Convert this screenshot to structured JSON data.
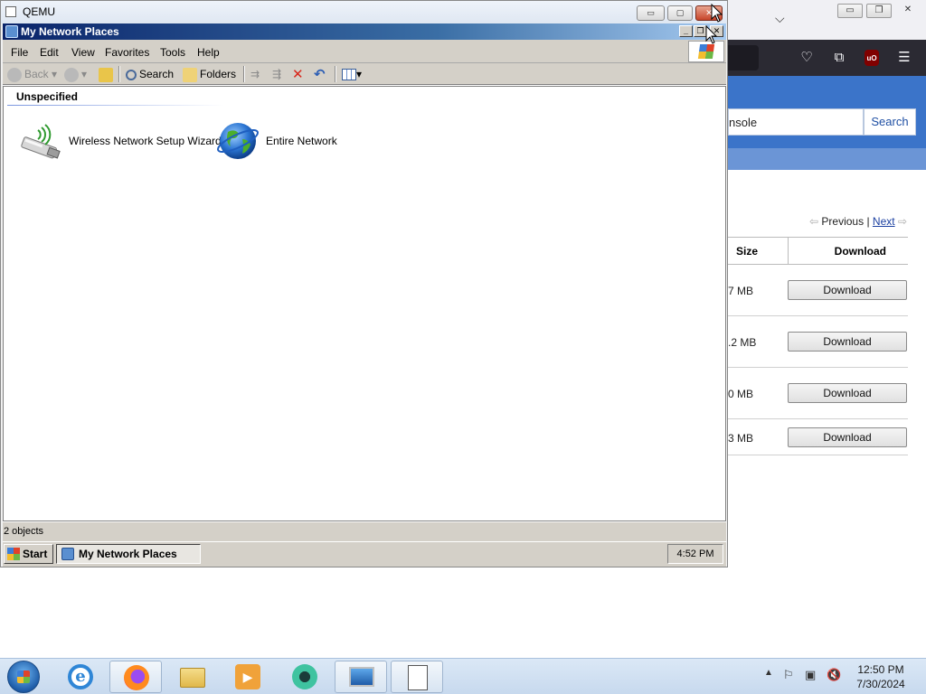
{
  "qemu": {
    "title": "QEMU",
    "buttons": {
      "minimize": "▭",
      "maximize": "▢",
      "close": "✕"
    }
  },
  "xp_window": {
    "title": "My Network Places",
    "menu": [
      "File",
      "Edit",
      "View",
      "Favorites",
      "Tools",
      "Help"
    ],
    "toolbar": {
      "back": "Back",
      "search": "Search",
      "folders": "Folders"
    },
    "group_header": "Unspecified",
    "items": [
      {
        "label": "Wireless Network Setup Wizard",
        "icon": "wireless-usb-icon"
      },
      {
        "label": "Entire Network",
        "icon": "globe-icon"
      }
    ],
    "status": "2 objects"
  },
  "xp_taskbar": {
    "start": "Start",
    "task": "My Network Places",
    "clock": "4:52 PM"
  },
  "browser": {
    "search_value": "nsole",
    "search_button": "Search",
    "pager": {
      "previous": "Previous",
      "separator": "|",
      "next": "Next"
    },
    "table": {
      "headers": {
        "size": "Size",
        "download": "Download"
      },
      "rows": [
        {
          "size": "7 MB",
          "button": "Download"
        },
        {
          "size": ".2 MB",
          "button": "Download"
        },
        {
          "size": "0 MB",
          "button": "Download"
        },
        {
          "size": "3 MB",
          "button": "Download"
        }
      ]
    }
  },
  "host_taskbar": {
    "time": "12:50 PM",
    "date": "7/30/2024"
  }
}
